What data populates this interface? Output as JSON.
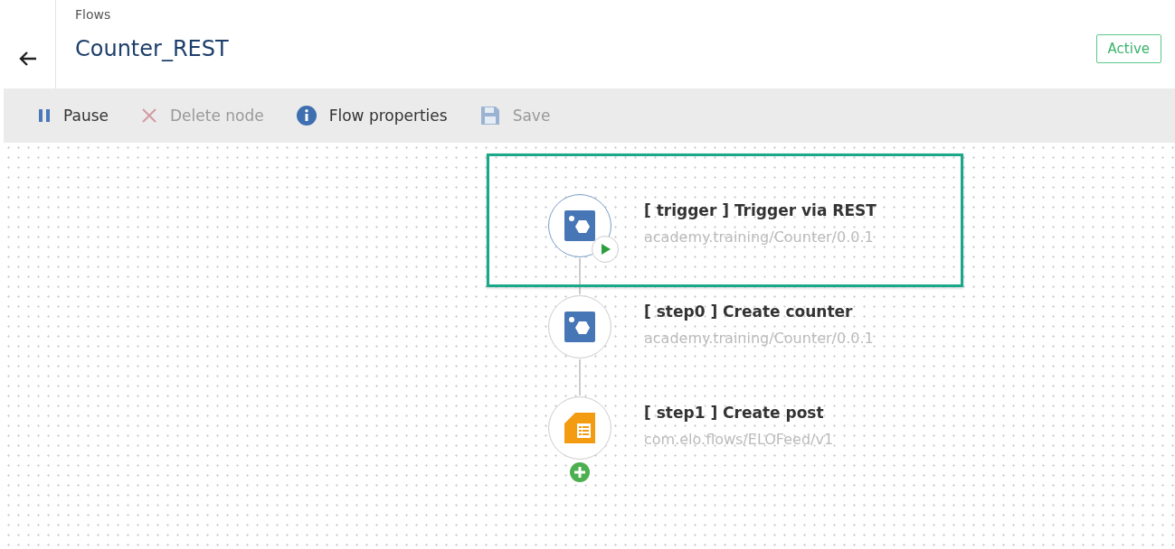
{
  "breadcrumb": "Flows",
  "title": "Counter_REST",
  "status": "Active",
  "toolbar": [
    {
      "label": "Pause",
      "kind": "pause",
      "disabled": false
    },
    {
      "label": "Delete node",
      "kind": "delete",
      "disabled": true
    },
    {
      "label": "Flow properties",
      "kind": "info",
      "disabled": false
    },
    {
      "label": "Save",
      "kind": "save",
      "disabled": true
    }
  ],
  "nodes": [
    {
      "tag": "[ trigger ]",
      "name": "Trigger via REST",
      "source": "academy.training/Counter/0.0.1",
      "kind": "service",
      "trigger": true,
      "selected": true
    },
    {
      "tag": "[ step0 ]",
      "name": "Create counter",
      "source": "academy.training/Counter/0.0.1",
      "kind": "service",
      "trigger": false,
      "selected": false
    },
    {
      "tag": "[ step1 ]",
      "name": "Create post",
      "source": "com.elo.flows/ELOFeed/v1",
      "kind": "feed",
      "trigger": false,
      "selected": false
    }
  ]
}
